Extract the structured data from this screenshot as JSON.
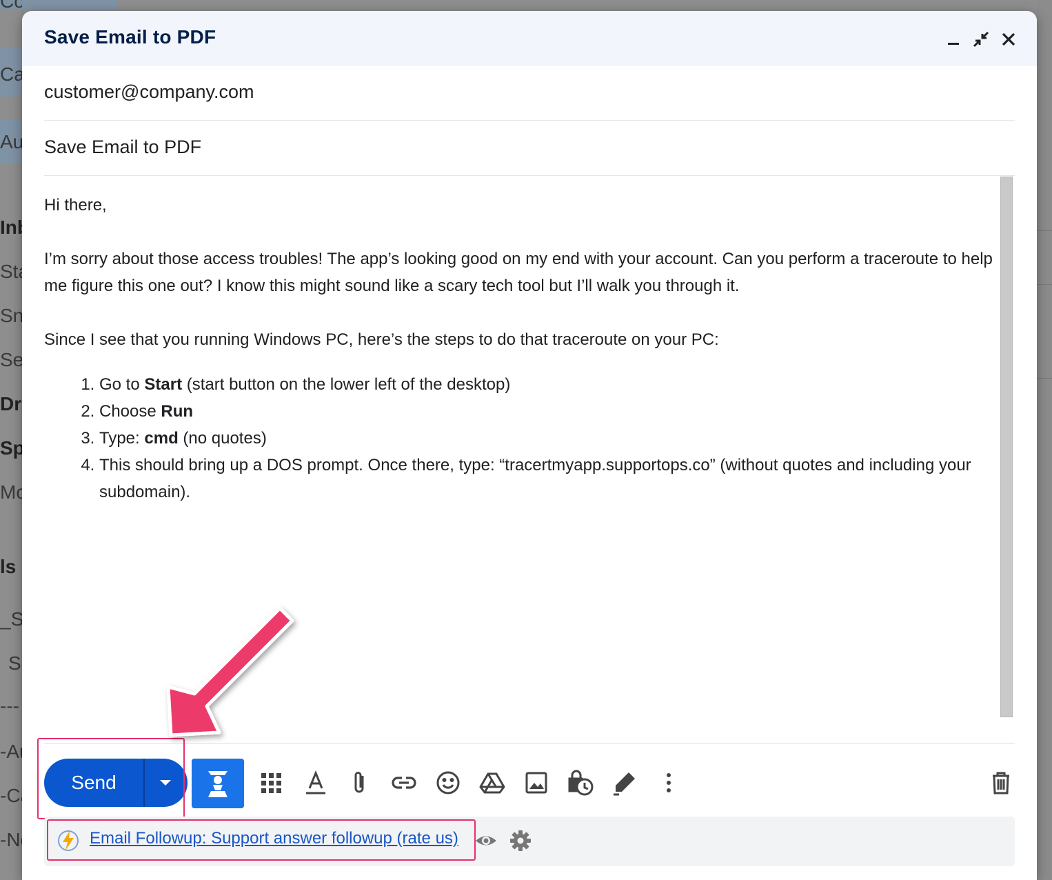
{
  "background": {
    "sidebar_fragments": [
      "Compose",
      "Ca",
      "Au",
      "Inb",
      "Sta",
      "Sn",
      "Se",
      "Dra",
      "Sp",
      "Mo",
      "ls",
      "_Su",
      "Sa",
      "---",
      "-Au",
      "-Ca",
      "-Ne"
    ]
  },
  "compose": {
    "title": "Save Email to PDF",
    "to": "customer@company.com",
    "subject": "Save Email to PDF",
    "body": {
      "greeting": "Hi there,",
      "paragraph1": "I’m sorry about those access troubles! The app’s looking good on my end with your account. Can you perform a traceroute to help me figure this one out? I know this might sound like a scary tech tool but I’ll walk you through it.",
      "paragraph2": "Since I see that you running Windows PC, here’s the steps to do that traceroute on your PC:",
      "steps": [
        {
          "pre": "Go to ",
          "bold": "Start",
          "post": " (start button on the lower left of the desktop)"
        },
        {
          "pre": "Choose ",
          "bold": "Run",
          "post": ""
        },
        {
          "pre": "Type: ",
          "bold": "cmd",
          "post": " (no quotes)"
        },
        {
          "pre": "This should bring up a DOS prompt. Once there, type: “tracertmyapp.supportops.co” (without quotes and including your subdomain).",
          "bold": "",
          "post": ""
        }
      ]
    },
    "send_label": "Send",
    "followup_label": "Email Followup: Support answer followup (rate us)",
    "toolbar_icons": [
      "chess-pawn-icon",
      "apps-grid-icon",
      "text-format-icon",
      "attachment-icon",
      "link-icon",
      "emoji-icon",
      "drive-icon",
      "image-icon",
      "schedule-lock-icon",
      "signature-pen-icon",
      "more-options-icon",
      "trash-icon"
    ],
    "colors": {
      "send": "#0b57d0",
      "highlight": "#e6306e",
      "titlebar": "#f2f6fc",
      "link": "#1a56c8"
    }
  }
}
